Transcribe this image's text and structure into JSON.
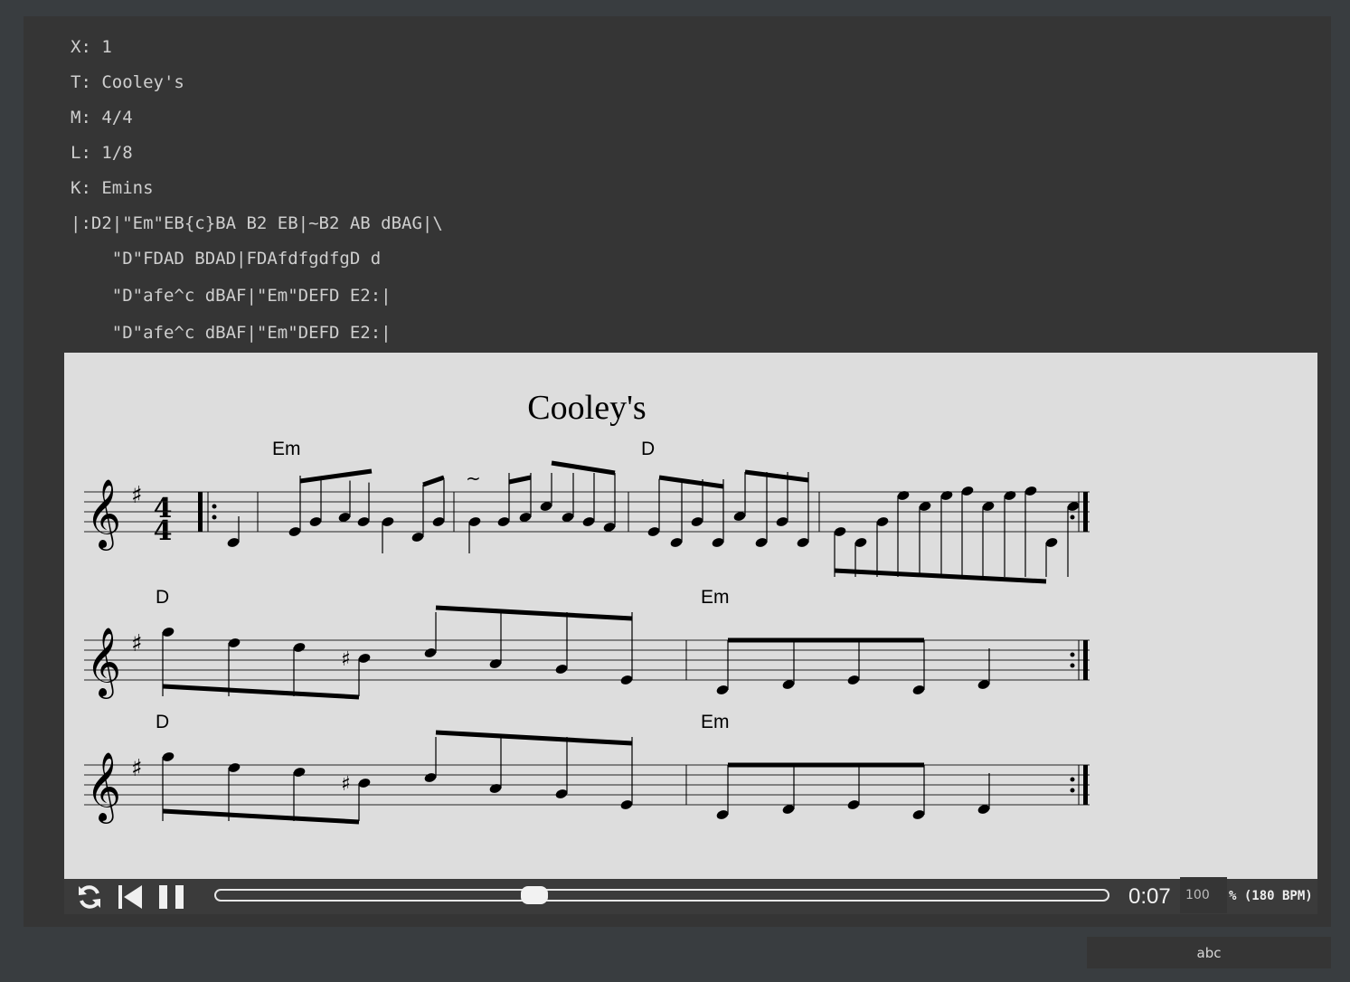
{
  "abc_source": {
    "lines": [
      "X: 1",
      "T: Cooley's",
      "M: 4/4",
      "L: 1/8",
      "K: Emins",
      "|:D2|\"Em\"EB{c}BA B2 EB|~B2 AB dBAG|\\",
      "    \"D\"FDAD BDAD|FDAfdfgdfgD d",
      "    \"D\"afe^c dBAF|\"Em\"DEFD E2:|",
      "    \"D\"afe^c dBAF|\"Em\"DEFD E2:|"
    ]
  },
  "sheet": {
    "title": "Cooley's",
    "chords": [
      "Em",
      "D",
      "D",
      "Em",
      "D",
      "Em"
    ],
    "time_signature": {
      "top": "4",
      "bottom": "4"
    }
  },
  "player": {
    "time": "0:07",
    "progress": 0.357,
    "tempo_value": "100",
    "tempo_label": "% (180 BPM)",
    "icons": [
      "loop-icon",
      "restart-icon",
      "pause-icon"
    ]
  },
  "tab": {
    "label": "abc"
  }
}
